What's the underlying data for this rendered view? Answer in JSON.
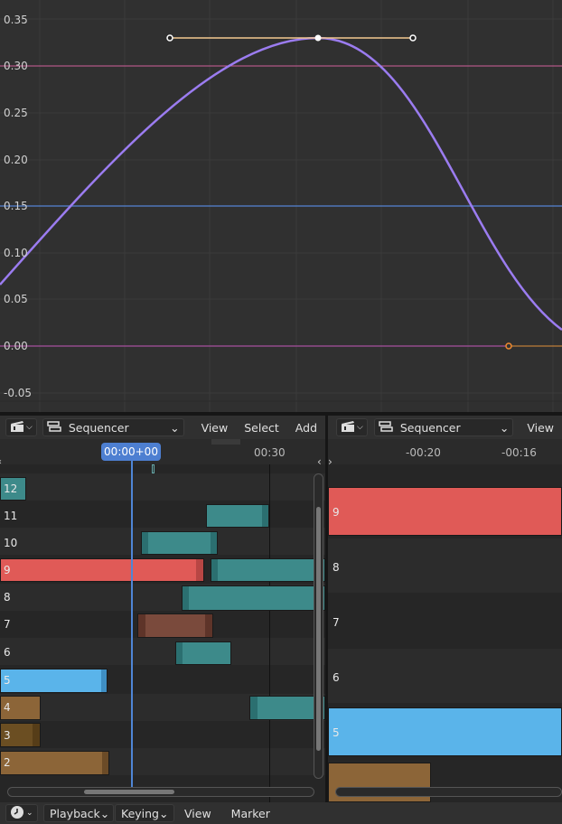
{
  "graph": {
    "y_ticks": [
      "0.35",
      "0.30",
      "0.25",
      "0.20",
      "0.15",
      "0.10",
      "0.05",
      "0.00",
      "-0.05"
    ]
  },
  "left_editor": {
    "editor_type": "Sequencer",
    "menus": [
      "View",
      "Select",
      "Add"
    ],
    "current_frame_label": "00:00+00",
    "ruler_label": "00:30",
    "channels": [
      "12",
      "11",
      "10",
      "9",
      "8",
      "7",
      "6",
      "5",
      "4",
      "3",
      "2"
    ]
  },
  "right_editor": {
    "editor_type": "Sequencer",
    "menus": [
      "View"
    ],
    "ruler_labels": [
      "-00:20",
      "-00:16"
    ],
    "channels": [
      "9",
      "8",
      "7",
      "6",
      "5"
    ]
  },
  "footer": {
    "playback": "Playback",
    "keying": "Keying",
    "view": "View",
    "marker": "Marker"
  },
  "icons": {
    "editor_type": "clapperboard-icon",
    "sequencer_mode": "sequencer-icon",
    "dropdown": "chevron-down-icon",
    "timeline_editor": "clock-icon"
  },
  "colors": {
    "curve": "#9b7cf0",
    "strip_red": "#e05a57",
    "strip_blue": "#5ab4ea",
    "strip_teal": "#3d8a8a",
    "strip_brown": "#7a4a3c",
    "strip_tan": "#8c6538",
    "playhead": "#4f86d6"
  }
}
